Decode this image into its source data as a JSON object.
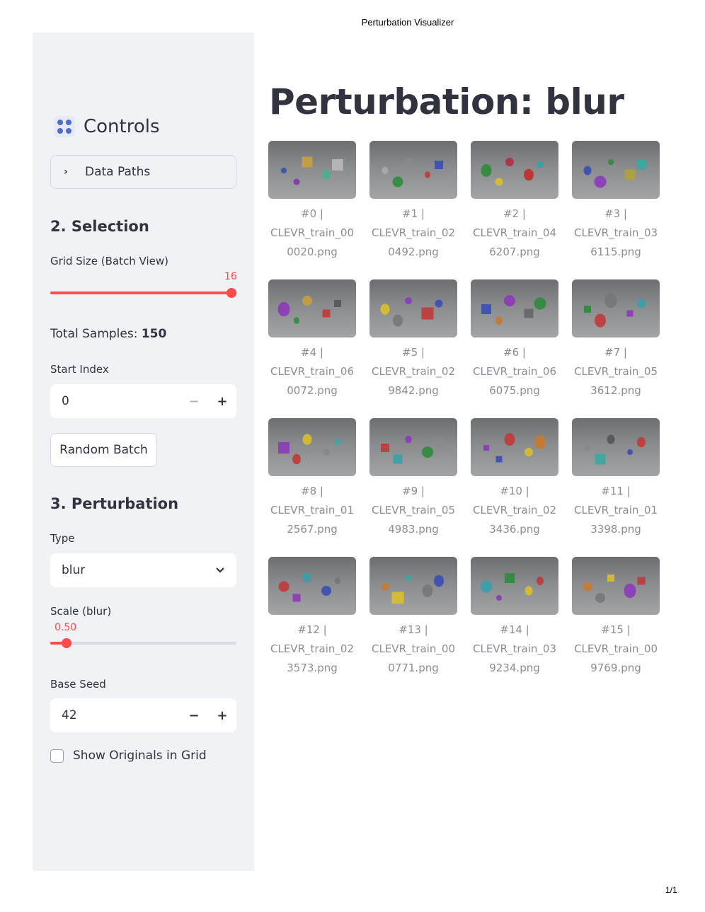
{
  "print": {
    "header": "Perturbation Visualizer",
    "footer": "1/1"
  },
  "sidebar": {
    "title": "Controls",
    "title_icon": "dice-emoji-icon",
    "expander": {
      "label": "Data Paths",
      "icon": "chevron-right-icon"
    },
    "selection": {
      "heading": "2. Selection",
      "grid_size": {
        "label": "Grid Size (Batch View)",
        "value": "16",
        "fraction": 1.0
      },
      "total_samples_label": "Total Samples:",
      "total_samples_value": "150",
      "start_index": {
        "label": "Start Index",
        "value": "0",
        "minus": "−",
        "plus": "+"
      },
      "random_batch_label": "Random Batch"
    },
    "perturbation": {
      "heading": "3. Perturbation",
      "type": {
        "label": "Type",
        "value": "blur",
        "icon": "chevron-down-icon"
      },
      "scale": {
        "label": "Scale (blur)",
        "value": "0.50",
        "fraction": 0.05
      },
      "base_seed": {
        "label": "Base Seed",
        "value": "42",
        "minus": "−",
        "plus": "+"
      },
      "show_originals_label": "Show Originals in Grid"
    }
  },
  "main": {
    "title": "Perturbation: blur",
    "images": [
      {
        "index": "#0 |",
        "file1": "CLEVR_train_00",
        "file2": "0020.png"
      },
      {
        "index": "#1 |",
        "file1": "CLEVR_train_02",
        "file2": "0492.png"
      },
      {
        "index": "#2 |",
        "file1": "CLEVR_train_04",
        "file2": "6207.png"
      },
      {
        "index": "#3 |",
        "file1": "CLEVR_train_03",
        "file2": "6115.png"
      },
      {
        "index": "#4 |",
        "file1": "CLEVR_train_06",
        "file2": "0072.png"
      },
      {
        "index": "#5 |",
        "file1": "CLEVR_train_02",
        "file2": "9842.png"
      },
      {
        "index": "#6 |",
        "file1": "CLEVR_train_06",
        "file2": "6075.png"
      },
      {
        "index": "#7 |",
        "file1": "CLEVR_train_05",
        "file2": "3612.png"
      },
      {
        "index": "#8 |",
        "file1": "CLEVR_train_01",
        "file2": "2567.png"
      },
      {
        "index": "#9 |",
        "file1": "CLEVR_train_05",
        "file2": "4983.png"
      },
      {
        "index": "#10 |",
        "file1": "CLEVR_train_02",
        "file2": "3436.png"
      },
      {
        "index": "#11 |",
        "file1": "CLEVR_train_01",
        "file2": "3398.png"
      },
      {
        "index": "#12 |",
        "file1": "CLEVR_train_02",
        "file2": "3573.png"
      },
      {
        "index": "#13 |",
        "file1": "CLEVR_train_00",
        "file2": "0771.png"
      },
      {
        "index": "#14 |",
        "file1": "CLEVR_train_03",
        "file2": "9234.png"
      },
      {
        "index": "#15 |",
        "file1": "CLEVR_train_00",
        "file2": "9769.png"
      }
    ]
  },
  "colors": {
    "accent": "#ff4b4b",
    "sidebar_bg": "#f0f2f6",
    "text": "#31333f",
    "caption": "#8a8d96"
  }
}
